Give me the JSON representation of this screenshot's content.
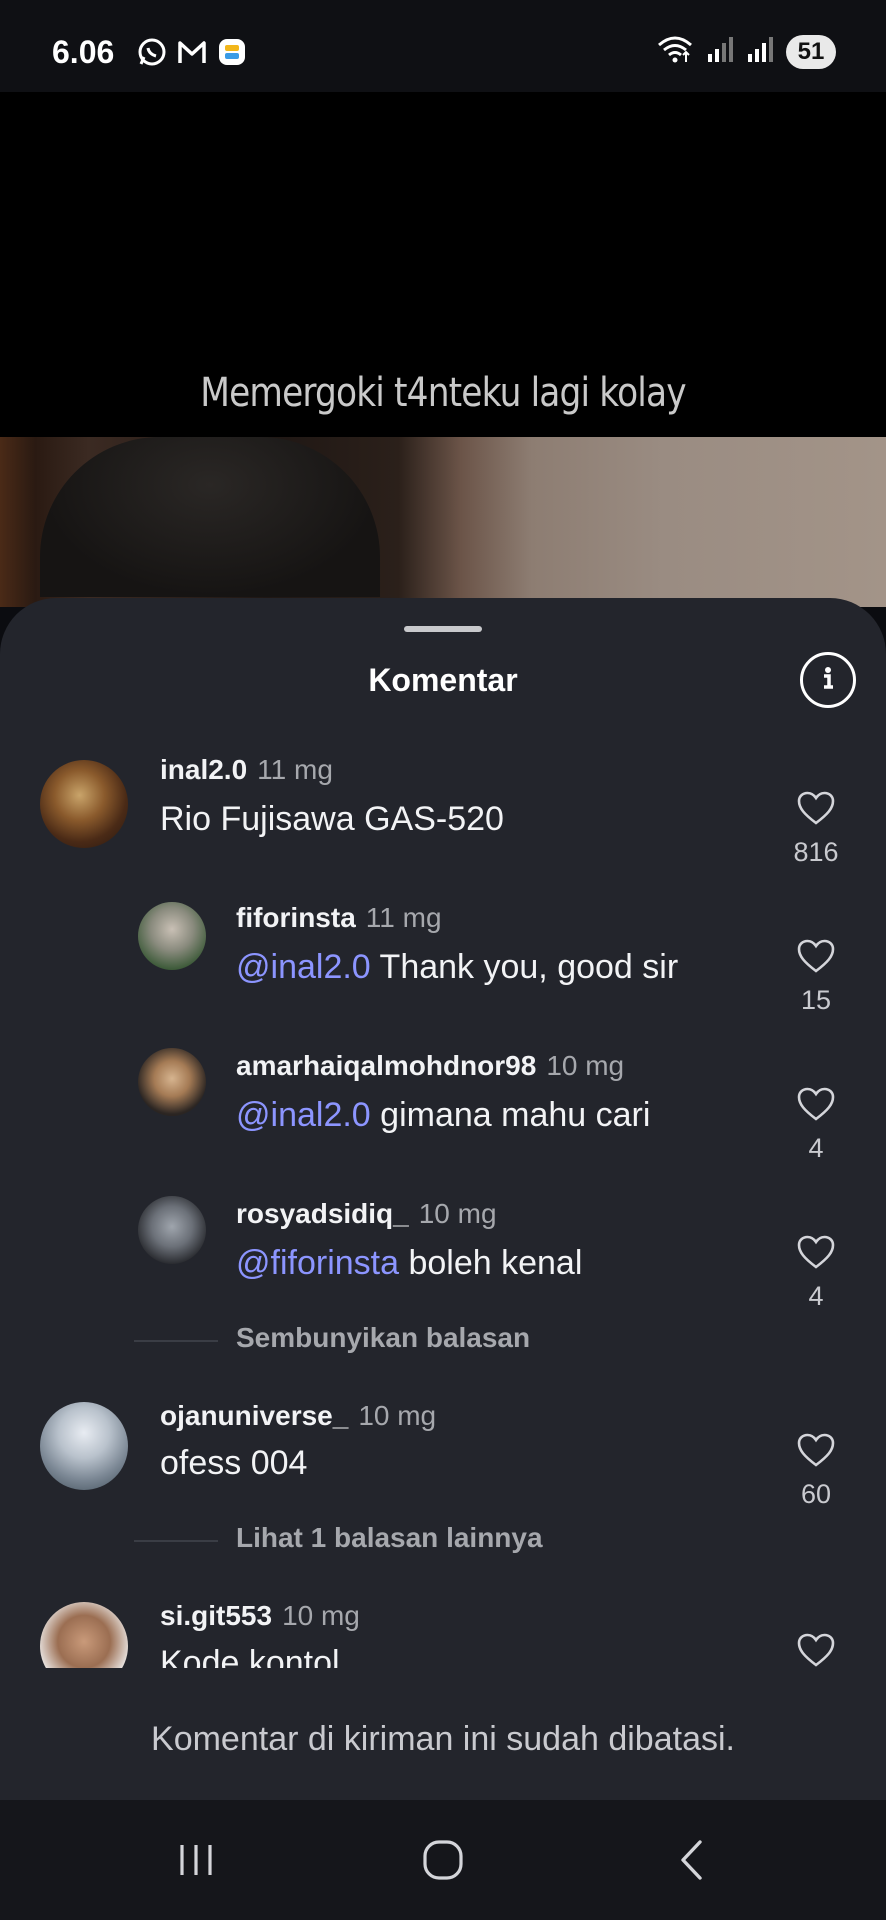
{
  "status_bar": {
    "time": "6.06",
    "battery": "51",
    "left_icons": [
      "whatsapp-icon",
      "gmail-icon",
      "app-icon"
    ],
    "right_icons": [
      "wifi-icon",
      "signal-icon",
      "signal-icon"
    ]
  },
  "video": {
    "caption": "Memergoki t4nteku lagi kolay"
  },
  "sheet": {
    "title": "Komentar",
    "info_icon": "info-icon"
  },
  "comments": [
    {
      "user": "inal2.0",
      "time": "11 mg",
      "mention": "",
      "text": "Rio Fujisawa GAS-520",
      "likes": "816"
    },
    {
      "user": "fiforinsta",
      "time": "11 mg",
      "mention": "@inal2.0",
      "text": " Thank you, good sir",
      "likes": "15"
    },
    {
      "user": "amarhaiqalmohdnor98",
      "time": "10 mg",
      "mention": "@inal2.0",
      "text": " gimana mahu cari",
      "likes": "4"
    },
    {
      "user": "rosyadsidiq_",
      "time": "10 mg",
      "mention": "@fiforinsta",
      "text": " boleh kenal",
      "likes": "4"
    },
    {
      "user": "ojanuniverse_",
      "time": "10 mg",
      "mention": "",
      "text": "ofess 004",
      "likes": "60"
    },
    {
      "user": "si.git553",
      "time": "10 mg",
      "mention": "",
      "text": "Kode kontol",
      "likes": ""
    }
  ],
  "toggles": {
    "hide_replies": "Sembunyikan balasan",
    "more_replies": "Lihat 1 balasan lainnya"
  },
  "footer": {
    "restricted": "Komentar di kiriman ini sudah dibatasi."
  },
  "colors": {
    "sheet_bg": "#23252c",
    "mention": "#8c95ff",
    "muted": "#a6a8ad"
  }
}
